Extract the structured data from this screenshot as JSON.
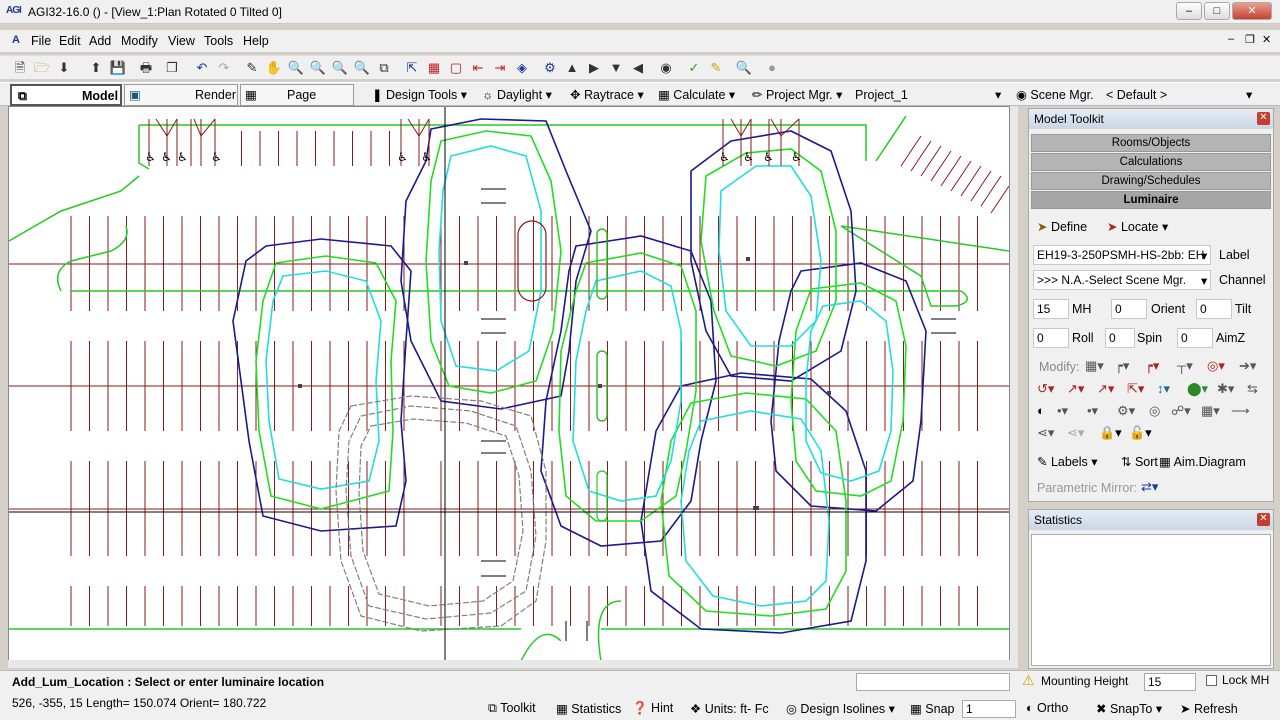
{
  "window": {
    "logo": "AGI",
    "title": "AGI32-16.0 () - [View_1:Plan Rotated 0 Tilted 0]"
  },
  "menu": [
    "File",
    "Edit",
    "Add",
    "Modify",
    "View",
    "Tools",
    "Help"
  ],
  "tabs": {
    "model": "Model",
    "render": "Render",
    "page_builder": "Page Builder"
  },
  "toolbar2": {
    "design_tools": "Design Tools",
    "daylight": "Daylight",
    "raytrace": "Raytrace",
    "calculate": "Calculate",
    "project_mgr": "Project Mgr.",
    "project_value": "Project_1",
    "scene_mgr": "Scene Mgr.",
    "scene_value": "< Default >"
  },
  "toolkit": {
    "title": "Model Toolkit",
    "categories": [
      "Rooms/Objects",
      "Calculations",
      "Drawing/Schedules",
      "Luminaire"
    ],
    "define": "Define",
    "locate": "Locate",
    "label_value": "EH19-3-250PSMH-HS-2bb: EH",
    "label_text": "Label",
    "channel_value": ">>> N.A.-Select Scene Mgr.",
    "channel_text": "Channel",
    "mh_value": "15",
    "mh_text": "MH",
    "orient_value": "0",
    "orient_text": "Orient",
    "tilt_value": "0",
    "tilt_text": "Tilt",
    "roll_value": "0",
    "roll_text": "Roll",
    "spin_value": "0",
    "spin_text": "Spin",
    "aimz_value": "0",
    "aimz_text": "AimZ",
    "modify": "Modify:",
    "labels": "Labels",
    "sort": "Sort",
    "aim_diagram": "Aim.Diagram",
    "parametric_mirror": "Parametric Mirror:"
  },
  "statistics": {
    "title": "Statistics"
  },
  "status": {
    "command": "Add_Lum_Location : Select or enter luminaire location",
    "coords": "526, -355,  15 Length= 150.074 Orient= 180.722",
    "mounting_height": "Mounting Height",
    "mh_value": "15",
    "lock_mh": "Lock MH",
    "toolkit": "Toolkit",
    "statistics": "Statistics",
    "hint": "Hint",
    "units": "Units: ft- Fc",
    "design_isolines": "Design Isolines",
    "snap": "Snap",
    "snap_value": "1",
    "ortho": "Ortho",
    "snapto": "SnapTo",
    "refresh": "Refresh"
  },
  "colors": {
    "isoline_blue": "#1a1a8c",
    "isoline_green": "#22dd22",
    "isoline_cyan": "#22dddd",
    "isoline_gray": "#808080",
    "stall_lines": "#8b1a1a",
    "curb": "#22cc22"
  }
}
